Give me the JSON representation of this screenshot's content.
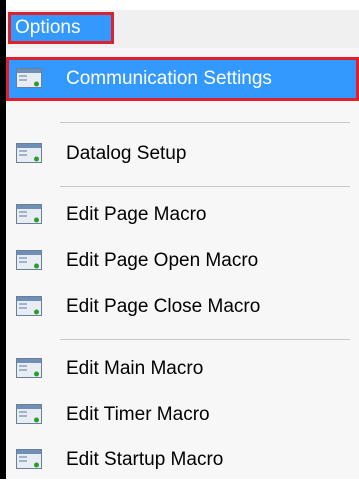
{
  "menu": {
    "title": "Options",
    "items": [
      {
        "label": "Communication Settings",
        "selected": true
      },
      {
        "label": "Datalog Setup"
      },
      {
        "label": "Edit Page Macro"
      },
      {
        "label": "Edit Page Open Macro"
      },
      {
        "label": "Edit Page Close Macro"
      },
      {
        "label": "Edit Main Macro"
      },
      {
        "label": "Edit Timer Macro"
      },
      {
        "label": "Edit Startup Macro"
      }
    ],
    "icon": "window-settings-icon"
  },
  "colors": {
    "selection": "#3399ff",
    "highlight_border": "#e0202a",
    "menu_background": "#f7f7f7",
    "separator": "#c8c8c8"
  }
}
